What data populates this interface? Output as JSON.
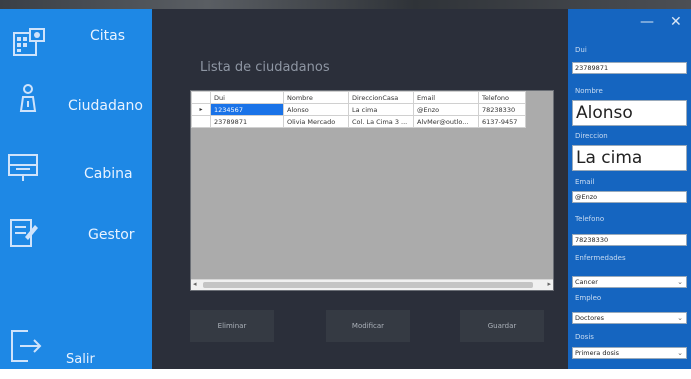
{
  "sidebar": {
    "items": [
      {
        "label": "Citas",
        "icon": "calendar-icon"
      },
      {
        "label": "Ciudadano",
        "icon": "person-icon"
      },
      {
        "label": "Cabina",
        "icon": "computer-icon"
      },
      {
        "label": "Gestor",
        "icon": "clipboard-icon"
      },
      {
        "label": "Salir",
        "icon": "exit-icon"
      }
    ]
  },
  "window": {
    "minimize": "—",
    "close": "✕"
  },
  "main": {
    "title": "Lista de ciudadanos",
    "grid": {
      "columns": [
        "Dui",
        "Nombre",
        "DireccionCasa",
        "Email",
        "Telefono"
      ],
      "rows": [
        {
          "marker": "▸",
          "cells": [
            "1234567",
            "Alonso",
            "La cima",
            "@Enzo",
            "78238330"
          ]
        },
        {
          "marker": "",
          "cells": [
            "23789871",
            "Olivia Mercado",
            "Col. La Cima 3 ...",
            "AlvMer@outlo...",
            "6137-9457"
          ]
        }
      ]
    },
    "buttons": {
      "delete": "Eliminar",
      "modify": "Modificar",
      "save": "Guardar"
    }
  },
  "form": {
    "dui_label": "Dui",
    "dui_value": "23789871",
    "nombre_label": "Nombre",
    "nombre_value": "Alonso",
    "direccion_label": "Direccion",
    "direccion_value": "La cima",
    "email_label": "Email",
    "email_value": "@Enzo",
    "telefono_label": "Telefono",
    "telefono_value": "78238330",
    "enfermedades_label": "Enfermedades",
    "enfermedades_value": "Cancer",
    "empleo_label": "Empleo",
    "empleo_value": "Doctores",
    "dosis_label": "Dosis",
    "dosis_value": "Primera dosis"
  },
  "colors": {
    "sidebar": "#1e88e5",
    "main": "#2b2f3a",
    "panel": "#1565c0",
    "grid_bg": "#ababab",
    "selected_row": "#1a73e8"
  }
}
